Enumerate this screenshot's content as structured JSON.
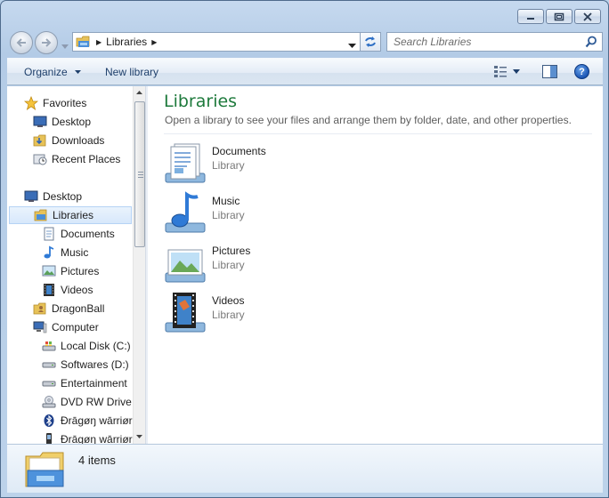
{
  "window": {
    "title": "Libraries"
  },
  "address": {
    "crumbs": [
      "Libraries"
    ]
  },
  "search": {
    "placeholder": "Search Libraries"
  },
  "toolbar": {
    "organize_label": "Organize",
    "new_library_label": "New library",
    "help_label": "?"
  },
  "nav": {
    "items": [
      {
        "label": "Favorites",
        "icon": "star-icon"
      },
      {
        "label": "Desktop",
        "icon": "desktop-icon"
      },
      {
        "label": "Downloads",
        "icon": "downloads-folder-icon"
      },
      {
        "label": "Recent Places",
        "icon": "recent-places-icon"
      },
      {
        "label": "Desktop",
        "icon": "desktop-icon"
      },
      {
        "label": "Libraries",
        "icon": "libraries-icon",
        "selected": true
      },
      {
        "label": "Documents",
        "icon": "documents-icon"
      },
      {
        "label": "Music",
        "icon": "music-icon"
      },
      {
        "label": "Pictures",
        "icon": "pictures-icon"
      },
      {
        "label": "Videos",
        "icon": "videos-icon"
      },
      {
        "label": "DragonBall",
        "icon": "user-folder-icon"
      },
      {
        "label": "Computer",
        "icon": "computer-icon"
      },
      {
        "label": "Local Disk (C:)",
        "icon": "system-drive-icon"
      },
      {
        "label": "Softwares (D:)",
        "icon": "drive-icon"
      },
      {
        "label": "Entertainment",
        "icon": "drive-icon"
      },
      {
        "label": "DVD RW Drive",
        "icon": "dvd-drive-icon"
      },
      {
        "label": "Đrāgøŋ wārriør",
        "icon": "bluetooth-icon"
      },
      {
        "label": "Đrāgøŋ wārriør",
        "icon": "phone-icon"
      }
    ]
  },
  "content": {
    "title": "Libraries",
    "description": "Open a library to see your files and arrange them by folder, date, and other properties.",
    "libraries": [
      {
        "name": "Documents",
        "type": "Library",
        "icon": "documents-library-icon"
      },
      {
        "name": "Music",
        "type": "Library",
        "icon": "music-library-icon"
      },
      {
        "name": "Pictures",
        "type": "Library",
        "icon": "pictures-library-icon"
      },
      {
        "name": "Videos",
        "type": "Library",
        "icon": "videos-library-icon"
      }
    ]
  },
  "details": {
    "count": "4 items"
  },
  "colors": {
    "title_green": "#1e7a3c",
    "command_text": "#1e3f6b",
    "selection": "#d7e8fb"
  }
}
